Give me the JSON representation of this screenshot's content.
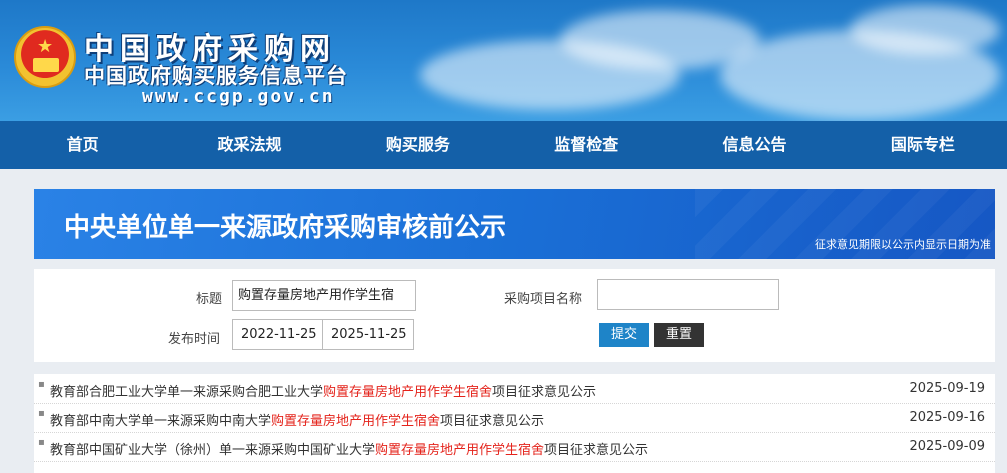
{
  "site": {
    "name": "中国政府采购网",
    "subtitle": "中国政府购买服务信息平台",
    "url": "www.ccgp.gov.cn"
  },
  "nav": [
    "首页",
    "政采法规",
    "购买服务",
    "监督检查",
    "信息公告",
    "国际专栏"
  ],
  "page": {
    "title": "中央单位单一来源政府采购审核前公示",
    "note": "征求意见期限以公示内显示日期为准"
  },
  "search": {
    "title_label": "标题",
    "title_value": "购置存量房地产用作学生宿",
    "project_label": "采购项目名称",
    "project_value": "",
    "date_label": "发布时间",
    "date_from": "2022-11-25",
    "date_to": "2025-11-25",
    "submit_label": "提交",
    "reset_label": "重置"
  },
  "results": [
    {
      "prefix": "教育部合肥工业大学单一来源采购合肥工业大学",
      "highlight": "购置存量房地产用作学生宿舍",
      "suffix": "项目征求意见公示",
      "date": "2025-09-19"
    },
    {
      "prefix": "教育部中南大学单一来源采购中南大学",
      "highlight": "购置存量房地产用作学生宿舍",
      "suffix": "项目征求意见公示",
      "date": "2025-09-16"
    },
    {
      "prefix": "教育部中国矿业大学（徐州）单一来源采购中国矿业大学",
      "highlight": "购置存量房地产用作学生宿舍",
      "suffix": "项目征求意见公示",
      "date": "2025-09-09"
    }
  ]
}
